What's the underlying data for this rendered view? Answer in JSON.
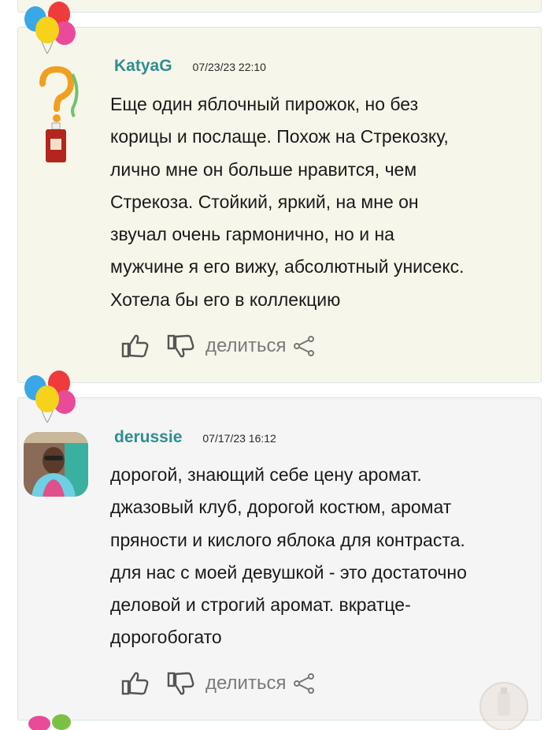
{
  "comments": [
    {
      "username": "KatyaG",
      "timestamp": "07/23/23 22:10",
      "lines": [
        "Еще один яблочный пирожок, но без",
        "корицы и послаще. Похож на Стрекозку,",
        "лично мне он больше нравится, чем",
        "Стрекоза. Стойкий, яркий, на мне он",
        "звучал очень гармонично, но и на",
        "мужчине я его вижу, абсолютный унисекс.",
        "Хотела бы его в коллекцию"
      ],
      "like_icon": "thumbs-up-icon",
      "dislike_icon": "thumbs-down-icon",
      "share_label": "делиться",
      "share_icon": "share-icon"
    },
    {
      "username": "derussie",
      "timestamp": "07/17/23 16:12",
      "lines": [
        "дорогой, знающий себе цену аромат.",
        "джазовый клуб, дорогой костюм, аромат",
        "пряности и кислого яблока для контраста.",
        "для нас с моей девушкой - это достаточно",
        "деловой и строгий аромат. вкратце-",
        "дорогобогато"
      ],
      "like_icon": "thumbs-up-icon",
      "dislike_icon": "thumbs-down-icon",
      "share_label": "делиться",
      "share_icon": "share-icon"
    }
  ],
  "colors": {
    "username": "#2e8e91",
    "card_beige": "#f7f6ea",
    "card_gray": "#f5f5f5",
    "border": "#d9e4e6",
    "muted": "#7a7a7a"
  }
}
